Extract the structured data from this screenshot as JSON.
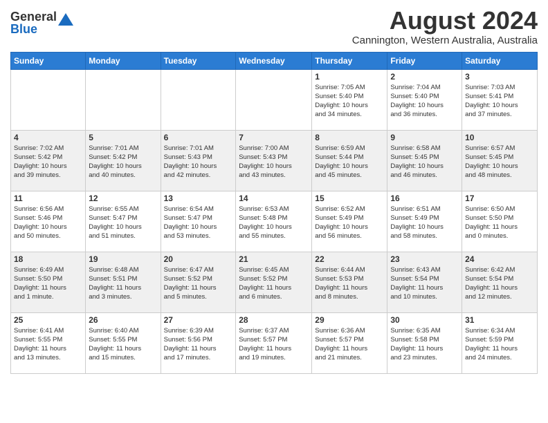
{
  "header": {
    "logo_general": "General",
    "logo_blue": "Blue",
    "month_year": "August 2024",
    "location": "Cannington, Western Australia, Australia"
  },
  "weekdays": [
    "Sunday",
    "Monday",
    "Tuesday",
    "Wednesday",
    "Thursday",
    "Friday",
    "Saturday"
  ],
  "weeks": [
    [
      {
        "day": "",
        "info": ""
      },
      {
        "day": "",
        "info": ""
      },
      {
        "day": "",
        "info": ""
      },
      {
        "day": "",
        "info": ""
      },
      {
        "day": "1",
        "info": "Sunrise: 7:05 AM\nSunset: 5:40 PM\nDaylight: 10 hours\nand 34 minutes."
      },
      {
        "day": "2",
        "info": "Sunrise: 7:04 AM\nSunset: 5:40 PM\nDaylight: 10 hours\nand 36 minutes."
      },
      {
        "day": "3",
        "info": "Sunrise: 7:03 AM\nSunset: 5:41 PM\nDaylight: 10 hours\nand 37 minutes."
      }
    ],
    [
      {
        "day": "4",
        "info": "Sunrise: 7:02 AM\nSunset: 5:42 PM\nDaylight: 10 hours\nand 39 minutes."
      },
      {
        "day": "5",
        "info": "Sunrise: 7:01 AM\nSunset: 5:42 PM\nDaylight: 10 hours\nand 40 minutes."
      },
      {
        "day": "6",
        "info": "Sunrise: 7:01 AM\nSunset: 5:43 PM\nDaylight: 10 hours\nand 42 minutes."
      },
      {
        "day": "7",
        "info": "Sunrise: 7:00 AM\nSunset: 5:43 PM\nDaylight: 10 hours\nand 43 minutes."
      },
      {
        "day": "8",
        "info": "Sunrise: 6:59 AM\nSunset: 5:44 PM\nDaylight: 10 hours\nand 45 minutes."
      },
      {
        "day": "9",
        "info": "Sunrise: 6:58 AM\nSunset: 5:45 PM\nDaylight: 10 hours\nand 46 minutes."
      },
      {
        "day": "10",
        "info": "Sunrise: 6:57 AM\nSunset: 5:45 PM\nDaylight: 10 hours\nand 48 minutes."
      }
    ],
    [
      {
        "day": "11",
        "info": "Sunrise: 6:56 AM\nSunset: 5:46 PM\nDaylight: 10 hours\nand 50 minutes."
      },
      {
        "day": "12",
        "info": "Sunrise: 6:55 AM\nSunset: 5:47 PM\nDaylight: 10 hours\nand 51 minutes."
      },
      {
        "day": "13",
        "info": "Sunrise: 6:54 AM\nSunset: 5:47 PM\nDaylight: 10 hours\nand 53 minutes."
      },
      {
        "day": "14",
        "info": "Sunrise: 6:53 AM\nSunset: 5:48 PM\nDaylight: 10 hours\nand 55 minutes."
      },
      {
        "day": "15",
        "info": "Sunrise: 6:52 AM\nSunset: 5:49 PM\nDaylight: 10 hours\nand 56 minutes."
      },
      {
        "day": "16",
        "info": "Sunrise: 6:51 AM\nSunset: 5:49 PM\nDaylight: 10 hours\nand 58 minutes."
      },
      {
        "day": "17",
        "info": "Sunrise: 6:50 AM\nSunset: 5:50 PM\nDaylight: 11 hours\nand 0 minutes."
      }
    ],
    [
      {
        "day": "18",
        "info": "Sunrise: 6:49 AM\nSunset: 5:50 PM\nDaylight: 11 hours\nand 1 minute."
      },
      {
        "day": "19",
        "info": "Sunrise: 6:48 AM\nSunset: 5:51 PM\nDaylight: 11 hours\nand 3 minutes."
      },
      {
        "day": "20",
        "info": "Sunrise: 6:47 AM\nSunset: 5:52 PM\nDaylight: 11 hours\nand 5 minutes."
      },
      {
        "day": "21",
        "info": "Sunrise: 6:45 AM\nSunset: 5:52 PM\nDaylight: 11 hours\nand 6 minutes."
      },
      {
        "day": "22",
        "info": "Sunrise: 6:44 AM\nSunset: 5:53 PM\nDaylight: 11 hours\nand 8 minutes."
      },
      {
        "day": "23",
        "info": "Sunrise: 6:43 AM\nSunset: 5:54 PM\nDaylight: 11 hours\nand 10 minutes."
      },
      {
        "day": "24",
        "info": "Sunrise: 6:42 AM\nSunset: 5:54 PM\nDaylight: 11 hours\nand 12 minutes."
      }
    ],
    [
      {
        "day": "25",
        "info": "Sunrise: 6:41 AM\nSunset: 5:55 PM\nDaylight: 11 hours\nand 13 minutes."
      },
      {
        "day": "26",
        "info": "Sunrise: 6:40 AM\nSunset: 5:55 PM\nDaylight: 11 hours\nand 15 minutes."
      },
      {
        "day": "27",
        "info": "Sunrise: 6:39 AM\nSunset: 5:56 PM\nDaylight: 11 hours\nand 17 minutes."
      },
      {
        "day": "28",
        "info": "Sunrise: 6:37 AM\nSunset: 5:57 PM\nDaylight: 11 hours\nand 19 minutes."
      },
      {
        "day": "29",
        "info": "Sunrise: 6:36 AM\nSunset: 5:57 PM\nDaylight: 11 hours\nand 21 minutes."
      },
      {
        "day": "30",
        "info": "Sunrise: 6:35 AM\nSunset: 5:58 PM\nDaylight: 11 hours\nand 23 minutes."
      },
      {
        "day": "31",
        "info": "Sunrise: 6:34 AM\nSunset: 5:59 PM\nDaylight: 11 hours\nand 24 minutes."
      }
    ]
  ]
}
